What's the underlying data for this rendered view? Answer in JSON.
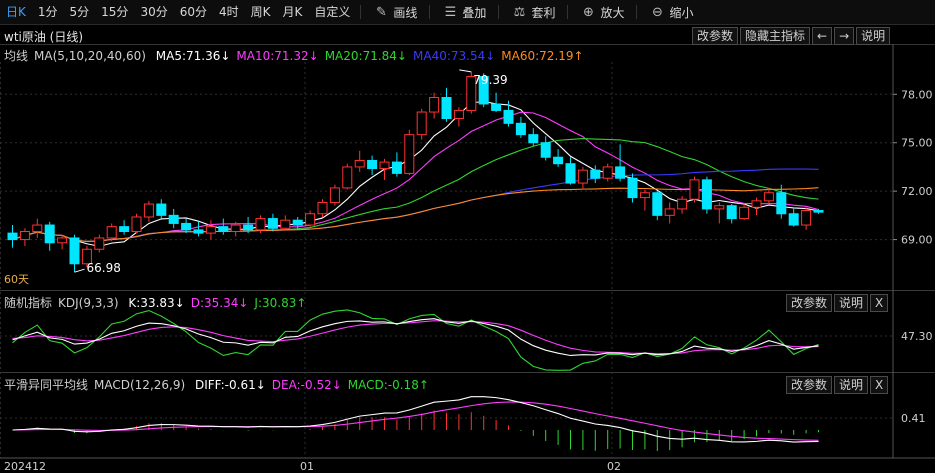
{
  "toolbar": {
    "periods": [
      "日K",
      "1分",
      "5分",
      "15分",
      "30分",
      "60分",
      "4时",
      "周K",
      "月K",
      "自定义"
    ],
    "active_period": "日K",
    "tools": [
      {
        "label": "画线",
        "icon": "pencil-icon",
        "glyph": "✎"
      },
      {
        "label": "叠加",
        "icon": "layers-icon",
        "glyph": "☰"
      },
      {
        "label": "套利",
        "icon": "arbitrage-icon",
        "glyph": "⚖"
      },
      {
        "label": "放大",
        "icon": "zoom-in-icon",
        "glyph": "⊕"
      },
      {
        "label": "缩小",
        "icon": "zoom-out-icon",
        "glyph": "⊖"
      }
    ]
  },
  "title": "wti原油 (日线)",
  "main_buttons": {
    "params": "改参数",
    "hide": "隐藏主指标",
    "left": "←",
    "right": "→",
    "help": "说明"
  },
  "ma_legend": {
    "name": "均线",
    "spec": "MA(5,10,20,40,60)",
    "items": [
      {
        "label": "MA5:71.36↓",
        "color": "#ffffff"
      },
      {
        "label": "MA10:71.32↓",
        "color": "#ff3cff"
      },
      {
        "label": "MA20:71.84↓",
        "color": "#2fd62f"
      },
      {
        "label": "MA40:73.54↓",
        "color": "#3a3aff"
      },
      {
        "label": "MA60:72.19↑",
        "color": "#ff8a1e"
      }
    ]
  },
  "sixty_label": "60天",
  "kdj_legend": {
    "name": "随机指标",
    "spec": "KDJ(9,3,3)",
    "items": [
      {
        "label": "K:33.83↓",
        "color": "#ffffff"
      },
      {
        "label": "D:35.34↓",
        "color": "#ff3cff"
      },
      {
        "label": "J:30.83↑",
        "color": "#2fd62f"
      }
    ]
  },
  "macd_legend": {
    "name": "平滑异同平均线",
    "spec": "MACD(12,26,9)",
    "items": [
      {
        "label": "DIFF:-0.61↓",
        "color": "#ffffff"
      },
      {
        "label": "DEA:-0.52↓",
        "color": "#ff3cff"
      },
      {
        "label": "MACD:-0.18↑",
        "color": "#2fd62f"
      }
    ]
  },
  "sub_buttons": {
    "params": "改参数",
    "help": "说明",
    "close": "X"
  },
  "chart_data": {
    "type": "candlestick",
    "price_ticks": [
      "78.00",
      "75.00",
      "72.00",
      "69.00"
    ],
    "kdj_tick": "47.30",
    "macd_tick": "0.41",
    "x_labels": [
      "202412",
      "01",
      "02"
    ],
    "annotations": {
      "high": "79.39",
      "low": "66.98"
    },
    "candles": [
      [
        69.4,
        69.9,
        68.5,
        69.0
      ],
      [
        69.0,
        69.7,
        68.6,
        69.5
      ],
      [
        69.5,
        70.3,
        69.1,
        69.9
      ],
      [
        69.9,
        70.1,
        68.3,
        68.8
      ],
      [
        68.8,
        69.3,
        68.4,
        69.1
      ],
      [
        69.1,
        69.3,
        66.98,
        67.5
      ],
      [
        67.5,
        68.6,
        67.3,
        68.4
      ],
      [
        68.4,
        69.3,
        68.2,
        69.1
      ],
      [
        69.1,
        70.0,
        68.9,
        69.8
      ],
      [
        69.8,
        70.2,
        69.3,
        69.5
      ],
      [
        69.5,
        70.6,
        69.4,
        70.4
      ],
      [
        70.4,
        71.4,
        70.1,
        71.2
      ],
      [
        71.2,
        71.5,
        70.3,
        70.5
      ],
      [
        70.5,
        70.9,
        69.7,
        70.0
      ],
      [
        70.0,
        70.3,
        69.4,
        69.6
      ],
      [
        69.6,
        70.1,
        69.2,
        69.4
      ],
      [
        69.4,
        70.2,
        69.0,
        69.8
      ],
      [
        69.8,
        70.3,
        69.3,
        69.5
      ],
      [
        69.5,
        70.1,
        69.2,
        69.9
      ],
      [
        69.9,
        70.4,
        69.4,
        69.6
      ],
      [
        69.6,
        70.5,
        69.4,
        70.3
      ],
      [
        70.3,
        70.6,
        69.5,
        69.7
      ],
      [
        69.7,
        70.5,
        69.6,
        70.2
      ],
      [
        70.2,
        70.4,
        69.6,
        69.9
      ],
      [
        69.9,
        70.8,
        69.8,
        70.6
      ],
      [
        70.6,
        71.5,
        70.4,
        71.3
      ],
      [
        71.3,
        72.4,
        71.1,
        72.2
      ],
      [
        72.2,
        73.7,
        72.1,
        73.5
      ],
      [
        73.5,
        74.5,
        73.2,
        73.9
      ],
      [
        73.9,
        74.2,
        73.0,
        73.4
      ],
      [
        73.4,
        74.0,
        72.7,
        73.8
      ],
      [
        73.8,
        74.4,
        72.9,
        73.1
      ],
      [
        73.1,
        75.8,
        73.0,
        75.5
      ],
      [
        75.5,
        77.1,
        75.2,
        76.9
      ],
      [
        76.9,
        78.1,
        76.5,
        77.8
      ],
      [
        77.8,
        78.4,
        76.3,
        76.5
      ],
      [
        76.5,
        77.2,
        76.0,
        77.0
      ],
      [
        77.0,
        79.39,
        76.8,
        79.1
      ],
      [
        79.1,
        79.3,
        77.2,
        77.4
      ],
      [
        77.4,
        78.1,
        76.9,
        77.0
      ],
      [
        77.0,
        77.6,
        76.0,
        76.2
      ],
      [
        76.2,
        76.6,
        75.3,
        75.5
      ],
      [
        75.5,
        75.9,
        74.8,
        75.0
      ],
      [
        75.0,
        75.4,
        73.9,
        74.1
      ],
      [
        74.1,
        74.6,
        73.5,
        73.7
      ],
      [
        73.7,
        74.1,
        72.4,
        72.5
      ],
      [
        72.5,
        73.5,
        72.1,
        73.3
      ],
      [
        73.3,
        73.6,
        72.5,
        72.8
      ],
      [
        72.8,
        73.7,
        72.6,
        73.5
      ],
      [
        73.5,
        74.9,
        72.6,
        72.8
      ],
      [
        72.8,
        73.1,
        71.3,
        71.6
      ],
      [
        71.6,
        72.1,
        70.8,
        71.9
      ],
      [
        71.9,
        72.0,
        70.2,
        70.5
      ],
      [
        70.5,
        71.3,
        70.0,
        70.9
      ],
      [
        70.9,
        71.7,
        70.6,
        71.5
      ],
      [
        71.5,
        72.9,
        71.3,
        72.7
      ],
      [
        72.7,
        72.9,
        70.6,
        70.9
      ],
      [
        70.9,
        71.3,
        70.0,
        71.1
      ],
      [
        71.1,
        71.2,
        70.0,
        70.3
      ],
      [
        70.3,
        71.2,
        70.2,
        71.0
      ],
      [
        71.0,
        71.6,
        70.5,
        71.4
      ],
      [
        71.4,
        72.2,
        71.2,
        71.9
      ],
      [
        71.9,
        72.4,
        70.3,
        70.6
      ],
      [
        70.6,
        71.0,
        69.8,
        69.9
      ],
      [
        69.9,
        71.0,
        69.6,
        70.8
      ],
      [
        70.8,
        70.9,
        70.6,
        70.7
      ]
    ]
  }
}
